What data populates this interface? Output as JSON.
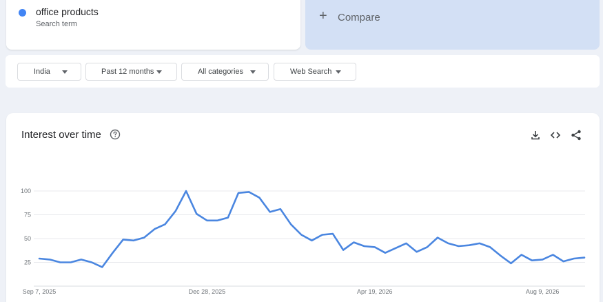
{
  "search_term": {
    "name": "office products",
    "subtitle": "Search term",
    "color": "#4285f4"
  },
  "compare": {
    "label": "Compare"
  },
  "filters": [
    {
      "label": "India"
    },
    {
      "label": "Past 12 months"
    },
    {
      "label": "All categories"
    },
    {
      "label": "Web Search"
    }
  ],
  "chart": {
    "title": "Interest over time",
    "icons": [
      "help-icon",
      "download-icon",
      "embed-icon",
      "share-icon"
    ]
  },
  "chart_data": {
    "type": "line",
    "title": "Interest over time",
    "xlabel": "",
    "ylabel": "",
    "ylim": [
      0,
      100
    ],
    "y_ticks": [
      25,
      50,
      75,
      100
    ],
    "x_tick_labels": [
      "Sep 7, 2025",
      "Dec 28, 2025",
      "Apr 19, 2026",
      "Aug 9, 2026"
    ],
    "grid": true,
    "series": [
      {
        "color": "#4a86e0",
        "values": [
          29,
          28,
          25,
          25,
          28,
          25,
          20,
          35,
          49,
          48,
          51,
          60,
          65,
          79,
          100,
          76,
          69,
          69,
          72,
          98,
          99,
          93,
          78,
          81,
          65,
          54,
          48,
          54,
          55,
          38,
          46,
          42,
          41,
          35,
          40,
          45,
          36,
          41,
          51,
          45,
          42,
          43,
          45,
          41,
          32,
          24,
          33,
          27,
          28,
          33,
          26,
          29,
          30
        ]
      }
    ]
  }
}
